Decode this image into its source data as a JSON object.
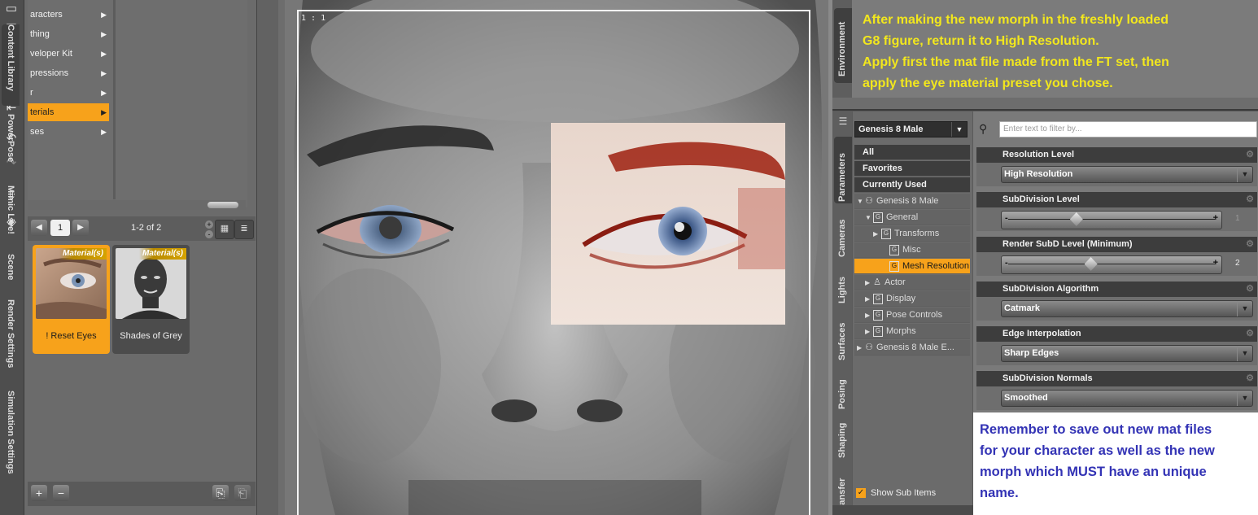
{
  "toolbar": {
    "icons": [
      "open-folder-icon",
      "open-recent-icon",
      "save-icon",
      "import-icon",
      "export-icon",
      "undo-icon",
      "redo-icon",
      "load-figure-icon",
      "load-prop-icon"
    ]
  },
  "content_library": {
    "tree_items": [
      {
        "label": "aracters",
        "selected": false
      },
      {
        "label": "thing",
        "selected": false
      },
      {
        "label": "veloper Kit",
        "selected": false
      },
      {
        "label": "pressions",
        "selected": false
      },
      {
        "label": "r",
        "selected": false
      },
      {
        "label": "terials",
        "selected": true
      },
      {
        "label": "ses",
        "selected": false
      }
    ],
    "page_number": "1",
    "page_info": "1-2 of 2",
    "tiles": [
      {
        "badge": "Material(s)",
        "label": "! Reset Eyes",
        "selected": true
      },
      {
        "badge": "Material(s)",
        "label": "Shades of Grey",
        "selected": false
      }
    ]
  },
  "side_tabs": [
    "Content Library",
    "PowerPose",
    "Mimic Live!",
    "Scene",
    "Render Settings",
    "Simulation Settings"
  ],
  "viewport": {
    "label": "1 : 1"
  },
  "right_tabs_top": [
    "Environment"
  ],
  "right_tabs": [
    "Parameters",
    "Cameras",
    "Lights",
    "Surfaces",
    "Posing",
    "Shaping",
    "Transfer"
  ],
  "note_top": [
    "After making the new morph in the freshly loaded",
    "G8 figure, return it to High Resolution.",
    "Apply first the mat file made from the FT set, then",
    "apply the eye material preset you chose."
  ],
  "parameters": {
    "node": "Genesis 8 Male",
    "filter_placeholder": "Enter text to filter by...",
    "tree": [
      {
        "label": "All",
        "kind": "cat",
        "indent": 0
      },
      {
        "label": "Favorites",
        "kind": "cat",
        "indent": 0
      },
      {
        "label": "Currently Used",
        "kind": "cat",
        "indent": 0
      },
      {
        "label": "Genesis 8 Male",
        "kind": "grp",
        "indent": 0
      },
      {
        "label": "General",
        "kind": "grp",
        "indent": 1
      },
      {
        "label": "Transforms",
        "kind": "grp",
        "indent": 2
      },
      {
        "label": "Misc",
        "kind": "grp",
        "indent": 3
      },
      {
        "label": "Mesh Resolution",
        "kind": "sel",
        "indent": 3
      },
      {
        "label": "Actor",
        "kind": "grp",
        "indent": 1
      },
      {
        "label": "Display",
        "kind": "grp",
        "indent": 1
      },
      {
        "label": "Pose Controls",
        "kind": "grp",
        "indent": 1
      },
      {
        "label": "Morphs",
        "kind": "grp",
        "indent": 1
      },
      {
        "label": "Genesis 8 Male E...",
        "kind": "grp",
        "indent": 0
      }
    ],
    "show_sub_items": "Show Sub Items",
    "properties": [
      {
        "title": "Resolution Level",
        "type": "dropdown",
        "value": "High Resolution"
      },
      {
        "title": "SubDivision Level",
        "type": "slider",
        "value": "1",
        "level": 0.33,
        "dim": true
      },
      {
        "title": "Render SubD Level (Minimum)",
        "type": "slider",
        "value": "2",
        "level": 0.4,
        "dim": false
      },
      {
        "title": "SubDivision Algorithm",
        "type": "dropdown",
        "value": "Catmark"
      },
      {
        "title": "Edge Interpolation",
        "type": "dropdown",
        "value": "Sharp Edges"
      },
      {
        "title": "SubDivision Normals",
        "type": "dropdown",
        "value": "Smoothed"
      }
    ]
  },
  "note_bottom": [
    "Remember to save out new mat files",
    "for your character as well as the new",
    "morph which MUST have an unique",
    "name."
  ],
  "colors": {
    "accent": "#f7a21b",
    "note_top_text": "#f2e71d",
    "note_bottom_text": "#3333b5"
  }
}
